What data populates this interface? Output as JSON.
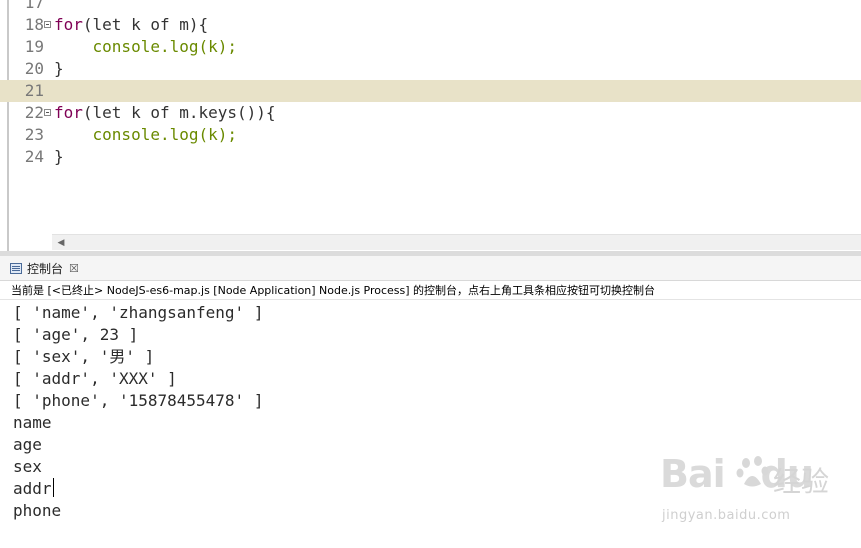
{
  "editor": {
    "lines": [
      {
        "num": "17",
        "text": "",
        "fold": false,
        "current": false
      },
      {
        "num": "18",
        "kind": "for",
        "head": "for",
        "rest": "(let k of m){",
        "fold": true,
        "current": false
      },
      {
        "num": "19",
        "kind": "call",
        "text": "    console.log(k);",
        "fold": false,
        "current": false
      },
      {
        "num": "20",
        "text": "}",
        "fold": false,
        "current": false
      },
      {
        "num": "21",
        "text": "",
        "fold": false,
        "current": true
      },
      {
        "num": "22",
        "kind": "for",
        "head": "for",
        "rest": "(let k of m.keys()){",
        "fold": true,
        "current": false
      },
      {
        "num": "23",
        "kind": "call",
        "text": "    console.log(k);",
        "fold": false,
        "current": false
      },
      {
        "num": "24",
        "text": "}",
        "fold": false,
        "current": false
      }
    ],
    "scroll_left_glyph": "◀"
  },
  "console": {
    "tab_label": "控制台",
    "close_glyph": "☒",
    "status": "当前是 [<已终止> NodeJS-es6-map.js [Node Application] Node.js Process] 的控制台，点右上角工具条相应按钮可切换控制台",
    "output": [
      "[ 'name', 'zhangsanfeng' ]",
      "[ 'age', 23 ]",
      "[ 'sex', '男' ]",
      "[ 'addr', 'XXX' ]",
      "[ 'phone', '15878455478' ]",
      "name",
      "age",
      "sex",
      "addr",
      "phone"
    ]
  },
  "watermark": {
    "logo": "Bai",
    "logo_suffix": "du",
    "cn": "经验",
    "url": "jingyan.baidu.com"
  }
}
